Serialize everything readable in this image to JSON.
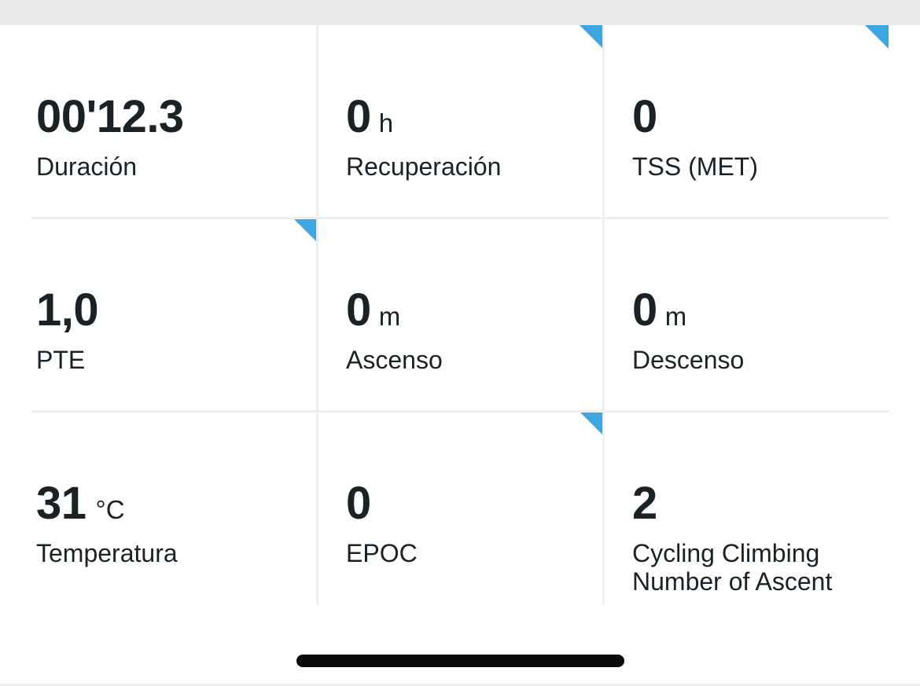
{
  "metrics": [
    {
      "value": "00'12.3",
      "unit": "",
      "label": "Duración",
      "corner_marker": false
    },
    {
      "value": "0",
      "unit": "h",
      "label": "Recuperación",
      "corner_marker": true
    },
    {
      "value": "0",
      "unit": "",
      "label": "TSS (MET)",
      "corner_marker": true
    },
    {
      "value": "1,0",
      "unit": "",
      "label": "PTE",
      "corner_marker": true
    },
    {
      "value": "0",
      "unit": "m",
      "label": "Ascenso",
      "corner_marker": false
    },
    {
      "value": "0",
      "unit": "m",
      "label": "Descenso",
      "corner_marker": false
    },
    {
      "value": "31",
      "unit": "°C",
      "label": "Temperatura",
      "corner_marker": false
    },
    {
      "value": "0",
      "unit": "",
      "label": "EPOC",
      "corner_marker": true
    },
    {
      "value": "2",
      "unit": "",
      "label": "Cycling Climbing Number of Ascent",
      "corner_marker": false
    }
  ],
  "colors": {
    "accent_corner": "#3ea7e2",
    "text": "#1a2226",
    "divider": "#eceef0",
    "top_strip": "#eaebed"
  }
}
